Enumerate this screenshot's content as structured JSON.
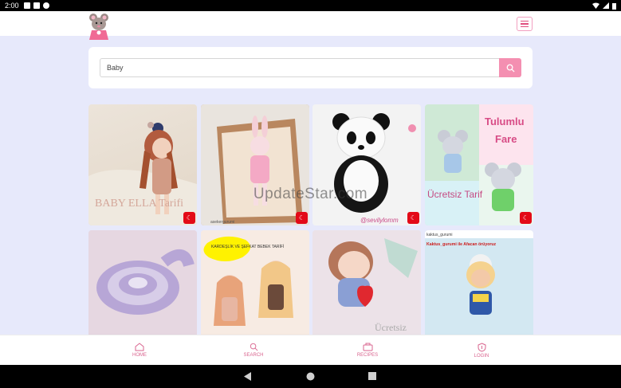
{
  "status": {
    "time": "2:00"
  },
  "search": {
    "placeholder": "Baby",
    "value": "Baby"
  },
  "tiles": [
    {
      "title": "BABY ELLA Tarifi",
      "handle": ""
    },
    {
      "title": "",
      "handle": "asekergurumi"
    },
    {
      "title": "",
      "handle": "@sevilylomm"
    },
    {
      "title": "Tulumlu Fare",
      "subtitle": "Ücretsiz Tarif",
      "handle": ""
    },
    {
      "title": "",
      "handle": ""
    },
    {
      "title": "KARDEŞLİK VE ŞEFKAT BEBEK TARİFİ",
      "handle": ""
    },
    {
      "title": "Ücretsiz",
      "handle": ""
    },
    {
      "title": "Kaktus_gurumi ile Afacan örüyoruz",
      "handle": "kaktus_gurumi"
    }
  ],
  "watermark": "UpdateStar.com",
  "nav": [
    {
      "label": "HOME",
      "icon": "home-icon"
    },
    {
      "label": "SEARCH",
      "icon": "search-icon"
    },
    {
      "label": "RECIPES",
      "icon": "recipes-icon"
    },
    {
      "label": "LOGIN",
      "icon": "login-icon"
    }
  ],
  "colors": {
    "accent": "#f48fb1",
    "nav": "#d9658f",
    "background": "#e7e9fb"
  }
}
